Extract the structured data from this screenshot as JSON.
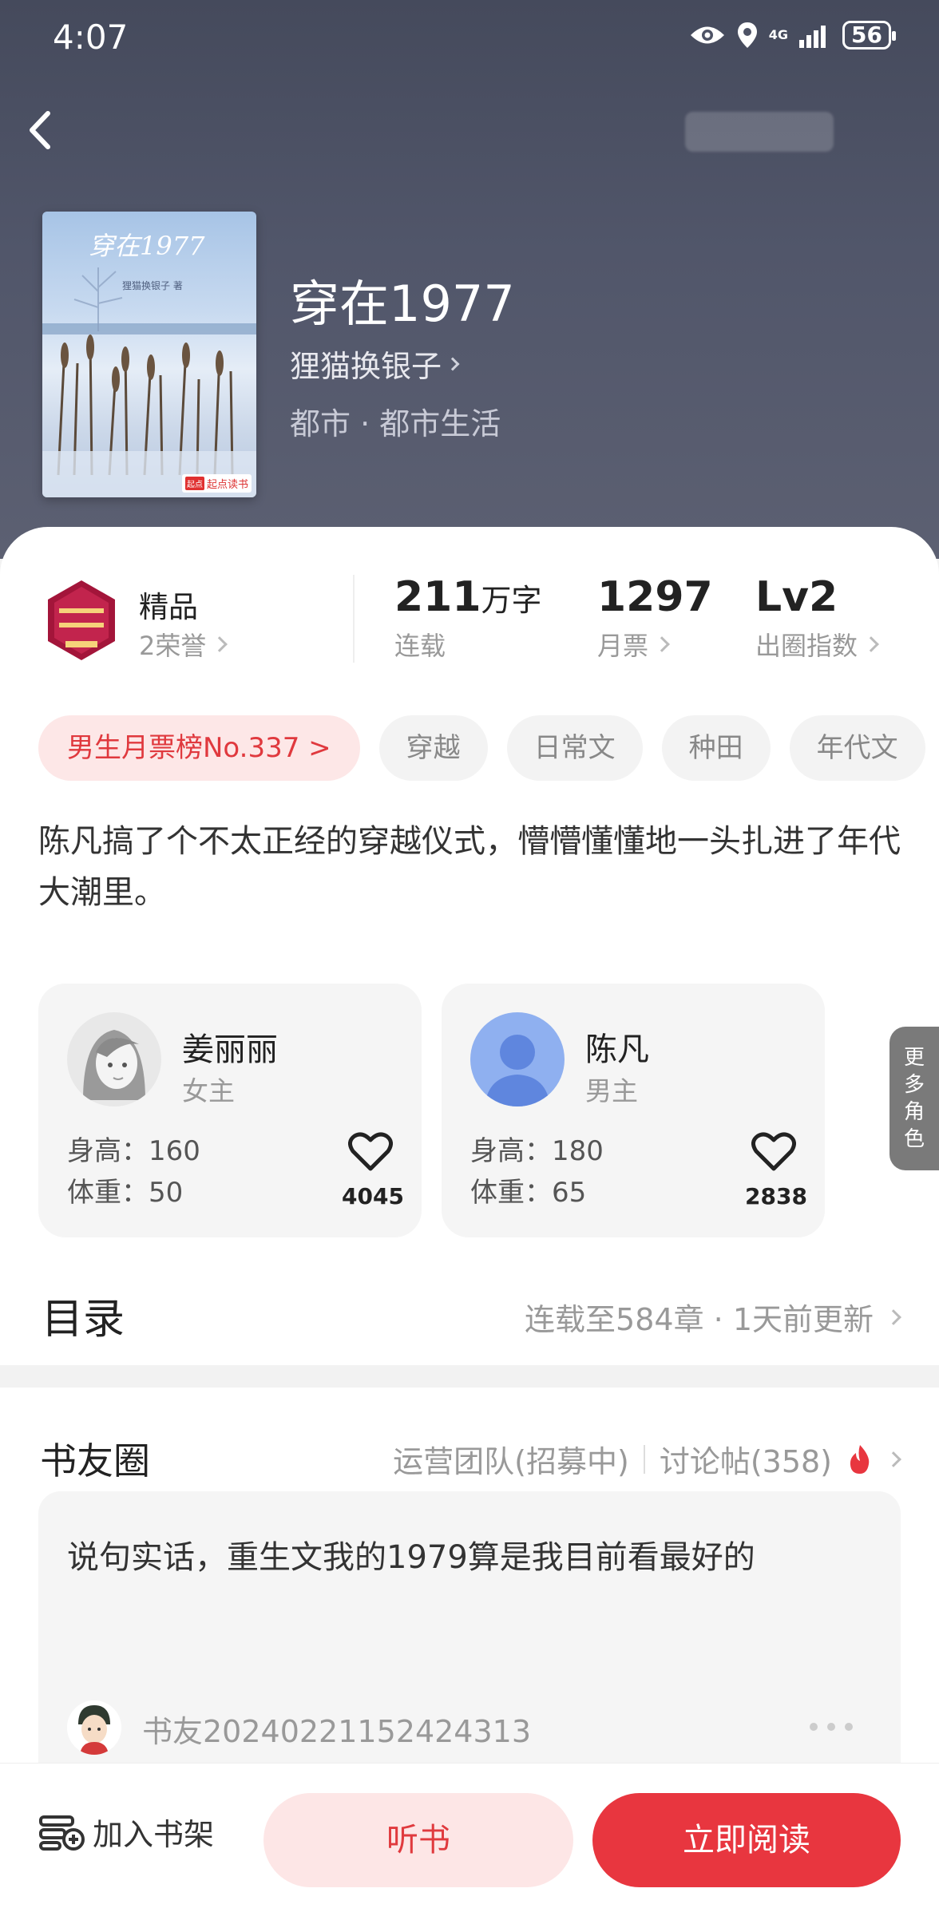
{
  "status_bar": {
    "time": "4:07",
    "network": "4G",
    "battery": "56"
  },
  "book": {
    "title": "穿在1977",
    "author": "狸猫换银子",
    "genre": "都市 · 都市生活",
    "cover_title": "穿在1977",
    "cover_author": "狸猫换银子 著",
    "cover_brand": "起点读书",
    "cover_brand_mark": "起点"
  },
  "stats": {
    "honor_title": "精品",
    "honor_sub": "2荣誉",
    "words_value": "211",
    "words_unit": "万字",
    "words_label": "连载",
    "tickets_value": "1297",
    "tickets_label": "月票",
    "index_value": "Lv2",
    "index_label": "出圈指数"
  },
  "tags": [
    "男生月票榜No.337 >",
    "穿越",
    "日常文",
    "种田",
    "年代文"
  ],
  "intro": "陈凡搞了个不太正经的穿越仪式，懵懵懂懂地一头扎进了年代大潮里。",
  "roles": [
    {
      "name": "姜丽丽",
      "type": "女主",
      "height": "身高：160",
      "weight": "体重：50",
      "likes": "4045"
    },
    {
      "name": "陈凡",
      "type": "男主",
      "height": "身高：180",
      "weight": "体重：65",
      "likes": "2838"
    }
  ],
  "more_roles": "更多角色",
  "catalog": {
    "title": "目录",
    "info": "连载至584章 · 1天前更新"
  },
  "circle": {
    "title": "书友圈",
    "team": "运营团队(招募中)",
    "posts": "讨论帖(358)",
    "post_text": "说句实话，重生文我的1979算是我目前看最好的",
    "post_user": "书友20240221152424313"
  },
  "bottom": {
    "shelf": "加入书架",
    "listen": "听书",
    "read": "立即阅读"
  },
  "colors": {
    "accent": "#e8363f",
    "accent_light": "#fde6e6",
    "header_bg": "#4b5063"
  },
  "icons": [
    "back-icon",
    "eye-icon",
    "location-icon",
    "signal-icon",
    "battery-icon",
    "chevron-right-icon",
    "heart-icon",
    "fire-icon",
    "bookshelf-add-icon",
    "more-dots-icon"
  ]
}
